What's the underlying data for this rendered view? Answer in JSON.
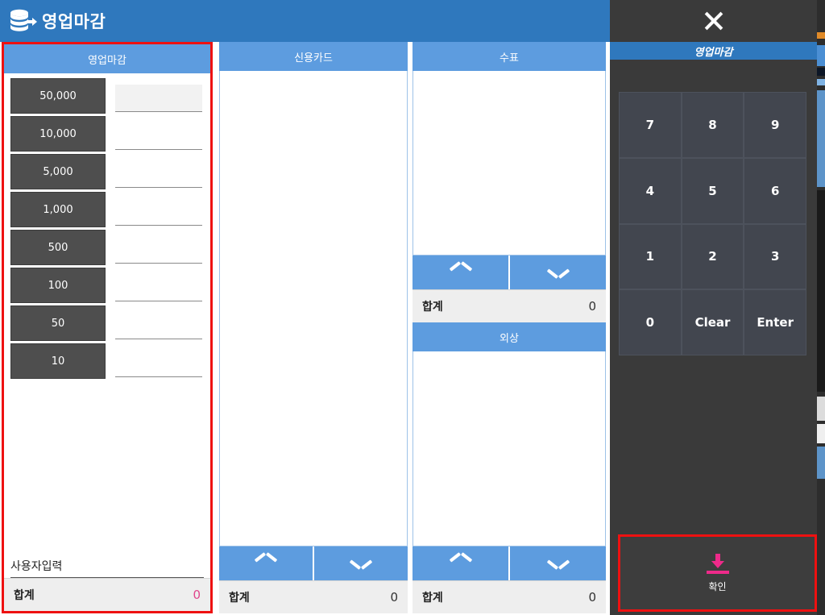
{
  "window": {
    "title": "영업마감",
    "title_icon": "coins-stack-arrow-icon",
    "close_icon": "close-x-icon",
    "accent_blue": "#2f78bd",
    "panel_blue": "#5d9cdf",
    "highlight_red": "#ee1111",
    "pink": "#e0468c"
  },
  "cash_panel": {
    "header": "영업마감",
    "denominations": [
      {
        "label": "50,000",
        "value": "",
        "focused": true
      },
      {
        "label": "10,000",
        "value": "",
        "focused": false
      },
      {
        "label": "5,000",
        "value": "",
        "focused": false
      },
      {
        "label": "1,000",
        "value": "",
        "focused": false
      },
      {
        "label": "500",
        "value": "",
        "focused": false
      },
      {
        "label": "100",
        "value": "",
        "focused": false
      },
      {
        "label": "50",
        "value": "",
        "focused": false
      },
      {
        "label": "10",
        "value": "",
        "focused": false
      }
    ],
    "user_input_label": "사용자입력",
    "user_input_value": "",
    "total_label": "합계",
    "total_value": "0"
  },
  "card_panel": {
    "header": "신용카드",
    "rows": [],
    "scroll_up_icon": "chevron-up-icon",
    "scroll_down_icon": "chevron-down-icon",
    "total_label": "합계",
    "total_value": "0"
  },
  "check_panel": {
    "header": "수표",
    "rows": [],
    "scroll_up_icon": "chevron-up-icon",
    "scroll_down_icon": "chevron-down-icon",
    "total_label": "합계",
    "total_value": "0"
  },
  "credit_panel": {
    "header": "외상",
    "rows": [],
    "scroll_up_icon": "chevron-up-icon",
    "scroll_down_icon": "chevron-down-icon",
    "total_label": "합계",
    "total_value": "0"
  },
  "sidebar": {
    "title": "영업마감",
    "keypad": [
      "7",
      "8",
      "9",
      "4",
      "5",
      "6",
      "1",
      "2",
      "3",
      "0",
      "Clear",
      "Enter"
    ],
    "confirm": {
      "label": "확인",
      "icon": "download-arrow-icon"
    }
  }
}
